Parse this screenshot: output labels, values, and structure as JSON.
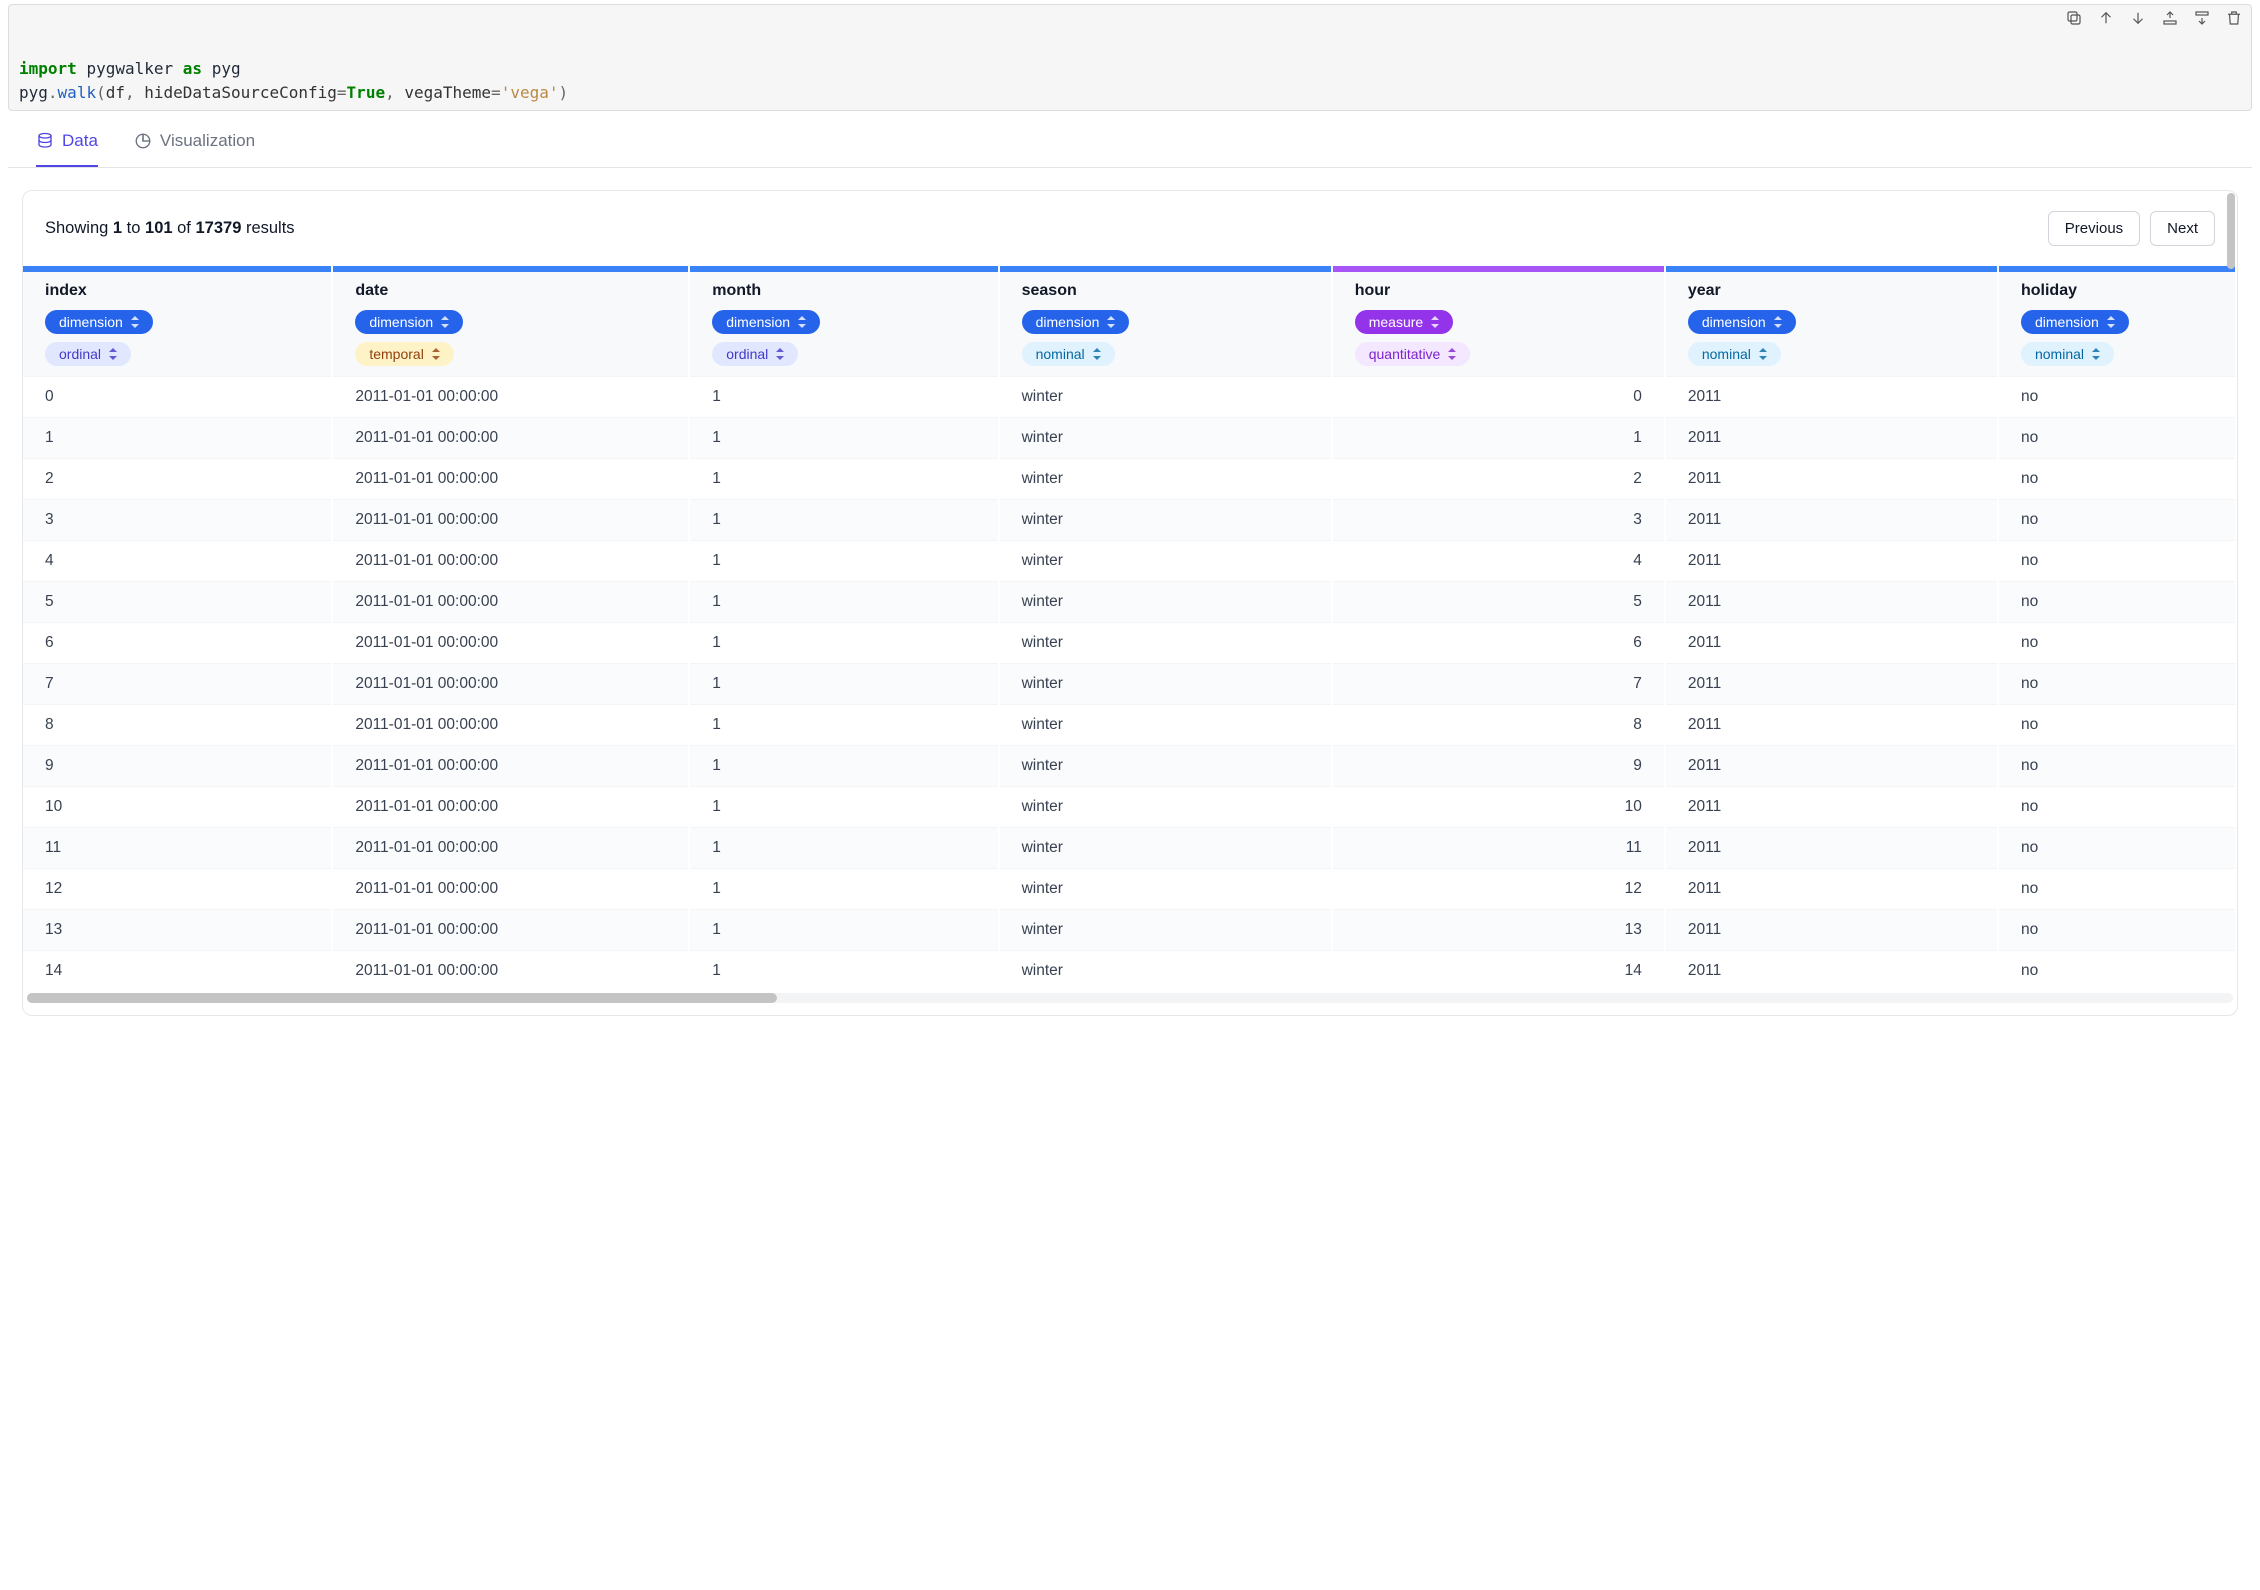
{
  "code": {
    "line1_parts": {
      "kw_import": "import",
      "pkg": "pygwalker",
      "kw_as": "as",
      "alias": "pyg"
    },
    "line2_parts": {
      "obj": "pyg",
      "dot": ".",
      "fn": "walk",
      "open": "(",
      "arg_df": "df",
      "sep1": ", ",
      "kw_hide": "hideDataSourceConfig",
      "eq1": "=",
      "true": "True",
      "sep2": ", ",
      "kw_theme": "vegaTheme",
      "eq2": "=",
      "str_vega": "'vega'",
      "close": ")"
    }
  },
  "tabs": {
    "data": "Data",
    "viz": "Visualization"
  },
  "summary": {
    "prefix": "Showing ",
    "from": "1",
    "mid1": " to ",
    "to": "101",
    "mid2": " of ",
    "total": "17379",
    "suffix": " results"
  },
  "pager": {
    "previous": "Previous",
    "next": "Next"
  },
  "pill_labels": {
    "dimension": "dimension",
    "measure": "measure",
    "ordinal": "ordinal",
    "temporal": "temporal",
    "nominal": "nominal",
    "quantitative": "quantitative"
  },
  "columns": [
    {
      "name": "index",
      "role": "dimension",
      "dtype": "ordinal"
    },
    {
      "name": "date",
      "role": "dimension",
      "dtype": "temporal"
    },
    {
      "name": "month",
      "role": "dimension",
      "dtype": "ordinal"
    },
    {
      "name": "season",
      "role": "dimension",
      "dtype": "nominal"
    },
    {
      "name": "hour",
      "role": "measure",
      "dtype": "quantitative"
    },
    {
      "name": "year",
      "role": "dimension",
      "dtype": "nominal"
    },
    {
      "name": "holiday",
      "role": "dimension",
      "dtype": "nominal"
    }
  ],
  "column_widths_pct": [
    13,
    15,
    13,
    14,
    14,
    14,
    10
  ],
  "numeric_columns": [
    "hour"
  ],
  "rows": [
    {
      "index": "0",
      "date": "2011-01-01 00:00:00",
      "month": "1",
      "season": "winter",
      "hour": "0",
      "year": "2011",
      "holiday": "no"
    },
    {
      "index": "1",
      "date": "2011-01-01 00:00:00",
      "month": "1",
      "season": "winter",
      "hour": "1",
      "year": "2011",
      "holiday": "no"
    },
    {
      "index": "2",
      "date": "2011-01-01 00:00:00",
      "month": "1",
      "season": "winter",
      "hour": "2",
      "year": "2011",
      "holiday": "no"
    },
    {
      "index": "3",
      "date": "2011-01-01 00:00:00",
      "month": "1",
      "season": "winter",
      "hour": "3",
      "year": "2011",
      "holiday": "no"
    },
    {
      "index": "4",
      "date": "2011-01-01 00:00:00",
      "month": "1",
      "season": "winter",
      "hour": "4",
      "year": "2011",
      "holiday": "no"
    },
    {
      "index": "5",
      "date": "2011-01-01 00:00:00",
      "month": "1",
      "season": "winter",
      "hour": "5",
      "year": "2011",
      "holiday": "no"
    },
    {
      "index": "6",
      "date": "2011-01-01 00:00:00",
      "month": "1",
      "season": "winter",
      "hour": "6",
      "year": "2011",
      "holiday": "no"
    },
    {
      "index": "7",
      "date": "2011-01-01 00:00:00",
      "month": "1",
      "season": "winter",
      "hour": "7",
      "year": "2011",
      "holiday": "no"
    },
    {
      "index": "8",
      "date": "2011-01-01 00:00:00",
      "month": "1",
      "season": "winter",
      "hour": "8",
      "year": "2011",
      "holiday": "no"
    },
    {
      "index": "9",
      "date": "2011-01-01 00:00:00",
      "month": "1",
      "season": "winter",
      "hour": "9",
      "year": "2011",
      "holiday": "no"
    },
    {
      "index": "10",
      "date": "2011-01-01 00:00:00",
      "month": "1",
      "season": "winter",
      "hour": "10",
      "year": "2011",
      "holiday": "no"
    },
    {
      "index": "11",
      "date": "2011-01-01 00:00:00",
      "month": "1",
      "season": "winter",
      "hour": "11",
      "year": "2011",
      "holiday": "no"
    },
    {
      "index": "12",
      "date": "2011-01-01 00:00:00",
      "month": "1",
      "season": "winter",
      "hour": "12",
      "year": "2011",
      "holiday": "no"
    },
    {
      "index": "13",
      "date": "2011-01-01 00:00:00",
      "month": "1",
      "season": "winter",
      "hour": "13",
      "year": "2011",
      "holiday": "no"
    },
    {
      "index": "14",
      "date": "2011-01-01 00:00:00",
      "month": "1",
      "season": "winter",
      "hour": "14",
      "year": "2011",
      "holiday": "no"
    }
  ]
}
